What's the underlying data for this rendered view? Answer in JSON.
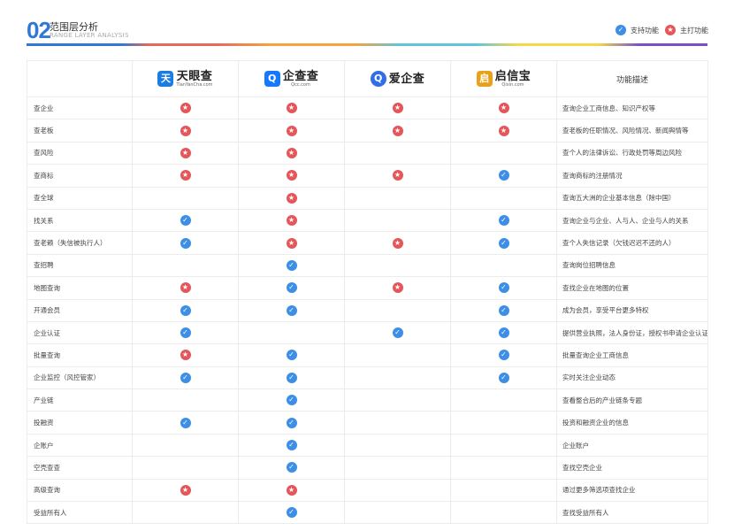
{
  "header": {
    "number": "02",
    "title": "范围层分析",
    "subtitle": "RANGE LAYER ANALYSIS"
  },
  "legend": {
    "support_label": "支持功能",
    "main_label": "主打功能"
  },
  "colors": {
    "accent": "#2f78d8",
    "check": "#3d8fe6",
    "star": "#e5565b"
  },
  "table": {
    "columns": [
      {
        "name": "天眼查",
        "sub": "TianYanCha.com",
        "icon": "tianyancha-logo",
        "color": "#1b7de3"
      },
      {
        "name": "企查查",
        "sub": "Qcc.com",
        "icon": "qichacha-logo",
        "color": "#1677ff"
      },
      {
        "name": "爱企查",
        "sub": "",
        "icon": "aiqicha-logo",
        "color": "#2f6ee8"
      },
      {
        "name": "启信宝",
        "sub": "Qixin.com",
        "icon": "qixinbao-logo",
        "color": "#e8a21a"
      }
    ],
    "desc_header": "功能描述",
    "rows": [
      {
        "name": "查企业",
        "marks": [
          "star",
          "star",
          "star",
          "star"
        ],
        "desc": "查询企业工商信息、知识产权等"
      },
      {
        "name": "查老板",
        "marks": [
          "star",
          "star",
          "star",
          "star"
        ],
        "desc": "查老板的任职情况、风险情况、新闻舆情等"
      },
      {
        "name": "查风险",
        "marks": [
          "star",
          "star",
          "",
          ""
        ],
        "desc": "查个人的法律诉讼、行政处罚等周边风险"
      },
      {
        "name": "查商标",
        "marks": [
          "star",
          "star",
          "star",
          "check"
        ],
        "desc": "查询商标的注册情况"
      },
      {
        "name": "查全球",
        "marks": [
          "",
          "star",
          "",
          ""
        ],
        "desc": "查询五大洲的企业基本信息（除中国）"
      },
      {
        "name": "找关系",
        "marks": [
          "check",
          "star",
          "",
          "check"
        ],
        "desc": "查询企业与企业、人与人、企业与人的关系"
      },
      {
        "name": "查老赖（失信被执行人）",
        "marks": [
          "check",
          "star",
          "star",
          "check"
        ],
        "desc": "查个人失信记录（欠钱迟迟不还的人）"
      },
      {
        "name": "查招聘",
        "marks": [
          "",
          "check",
          "",
          ""
        ],
        "desc": "查询岗位招聘信息"
      },
      {
        "name": "地图查询",
        "marks": [
          "star",
          "check",
          "star",
          "check"
        ],
        "desc": "查找企业在地图的位置"
      },
      {
        "name": "开通会员",
        "marks": [
          "check",
          "check",
          "",
          "check"
        ],
        "desc": "成为会员，享受平台更多特权"
      },
      {
        "name": "企业认证",
        "marks": [
          "check",
          "",
          "check",
          "check"
        ],
        "desc": "提供营业执照，法人身份证，授权书申请企业认证"
      },
      {
        "name": "批量查询",
        "marks": [
          "star",
          "check",
          "",
          "check"
        ],
        "desc": "批量查询企业工商信息"
      },
      {
        "name": "企业监控（风控管家）",
        "marks": [
          "check",
          "check",
          "",
          "check"
        ],
        "desc": "实时关注企业动态"
      },
      {
        "name": "产业链",
        "marks": [
          "",
          "check",
          "",
          ""
        ],
        "desc": "查看整合后的产业链条专题"
      },
      {
        "name": "投融资",
        "marks": [
          "check",
          "check",
          "",
          ""
        ],
        "desc": "投资和融资企业的信息"
      },
      {
        "name": "企账户",
        "marks": [
          "",
          "check",
          "",
          ""
        ],
        "desc": "企业账户"
      },
      {
        "name": "空壳查查",
        "marks": [
          "",
          "check",
          "",
          ""
        ],
        "desc": "查找空壳企业"
      },
      {
        "name": "高级查询",
        "marks": [
          "star",
          "star",
          "",
          ""
        ],
        "desc": "通过更多筛选项查找企业"
      },
      {
        "name": "受益所有人",
        "marks": [
          "",
          "check",
          "",
          ""
        ],
        "desc": "查找受益所有人"
      }
    ]
  }
}
